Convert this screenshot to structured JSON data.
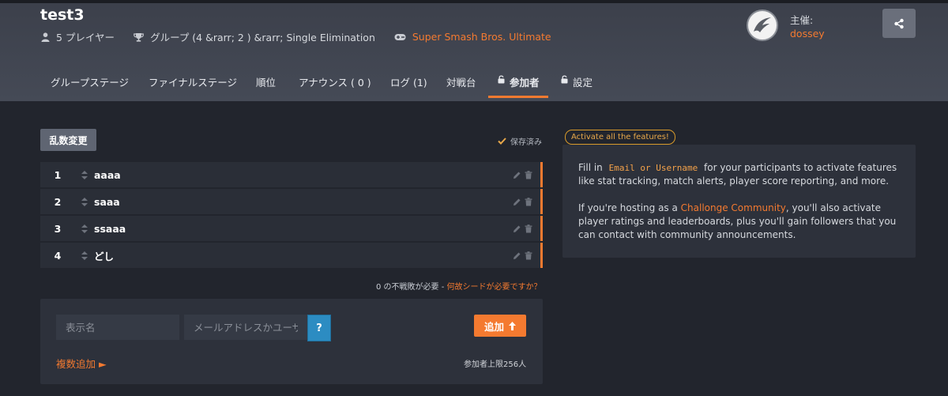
{
  "tournament": {
    "title": "test3",
    "players": "5 プレイヤー",
    "format": "グループ (4 &rarr; 2 ) &rarr; Single Elimination",
    "game": "Super Smash Bros. Ultimate"
  },
  "host": {
    "label": "主催:",
    "name": "dossey"
  },
  "tabs": [
    {
      "label": "グループステージ"
    },
    {
      "label": "ファイナルステージ"
    },
    {
      "label": "順位"
    },
    {
      "label": "アナウンス ( 0 )"
    },
    {
      "label": "ログ (1)"
    },
    {
      "label": "対戦台"
    },
    {
      "label": "参加者"
    },
    {
      "label": "設定"
    }
  ],
  "participants_section": {
    "randomize_label": "乱数変更",
    "saved_label": "保存済み",
    "participants": [
      {
        "seed": "1",
        "name": "aaaa"
      },
      {
        "seed": "2",
        "name": "saaa"
      },
      {
        "seed": "3",
        "name": "ssaaa"
      },
      {
        "seed": "4",
        "name": "どし"
      }
    ],
    "byes_text": "0 の不戦敗が必要 - ",
    "byes_link": "何故シードが必要ですか？"
  },
  "add_form": {
    "display_name_placeholder": "表示名",
    "email_placeholder": "メールアドレスかユーザーネーム",
    "help_label": "?",
    "add_label": "追加",
    "bulk_label": "複数追加 ►",
    "limit_text": "参加者上限256人"
  },
  "info": {
    "badge": "Activate all the features!",
    "p1_before": "Fill in ",
    "p1_code": "Email or Username",
    "p1_after": " for your participants to activate features like stat tracking, match alerts, player score reporting, and more.",
    "p2_before": "If you're hosting as a ",
    "p2_link": "Challonge Community",
    "p2_after": ", you'll also activate player ratings and leaderboards, plus you'll gain followers that you can contact with community announcements."
  },
  "colors": {
    "accent": "#f47a30",
    "header_bg": "#3c404b",
    "page_bg": "#22252d"
  }
}
